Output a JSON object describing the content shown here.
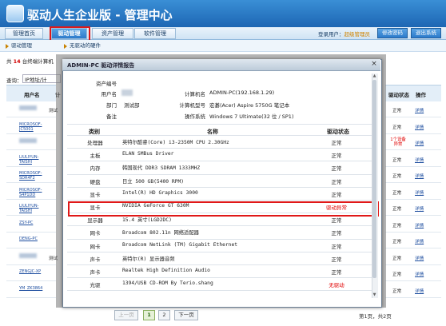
{
  "app": {
    "title": "驱动人生企业版 - 管理中心"
  },
  "nav": {
    "tabs": [
      "管理首页",
      "驱动管理",
      "资产管理",
      "软件管理"
    ],
    "login_label": "登录用户：",
    "login_user": "超级管理员",
    "change_password": "修改密码",
    "logout": "退出系统"
  },
  "subnav": {
    "items": [
      "驱动管理",
      "无驱动的硬件"
    ]
  },
  "background": {
    "count_prefix": "共",
    "count_value": "14",
    "count_suffix": "台终端计算机",
    "ip_label": "查询：",
    "ip_value": "IP地址/计",
    "col_username": "用户名",
    "col_status": "驱动状态",
    "col_action": "操作",
    "col_partial": "计",
    "rows": [
      {
        "name": "",
        "dept": "测试",
        "status": "正常",
        "action": "详情",
        "blur": true
      },
      {
        "name": "MICROSOF-JC5001",
        "dept": "",
        "status": "正常",
        "action": "详情"
      },
      {
        "name": "",
        "dept": "",
        "status": "1个设备异常",
        "action": "详情",
        "blur": true
      },
      {
        "name": "LIULIYUN-TAISHI",
        "dept": "",
        "status": "正常",
        "action": "详情"
      },
      {
        "name": "MICROSOF-SDR4F2",
        "dept": "",
        "status": "正常",
        "action": "详情"
      },
      {
        "name": "MICROSOF-S4P1DD",
        "dept": "",
        "status": "正常",
        "action": "详情"
      },
      {
        "name": "LIULIYUN-TAISHI",
        "dept": "",
        "status": "正常",
        "action": "详情"
      },
      {
        "name": "ZSY-PC",
        "dept": "",
        "status": "正常",
        "action": "详情"
      },
      {
        "name": "DENG-PC",
        "dept": "",
        "status": "正常",
        "action": "详情"
      },
      {
        "name": "",
        "dept": "测试",
        "status": "正常",
        "action": "详情",
        "blur": true
      },
      {
        "name": "ZENGJC-XP",
        "dept": "",
        "status": "正常",
        "action": "详情"
      },
      {
        "name": "YM_ZK3864",
        "dept": "",
        "status": "正常",
        "action": "详情"
      }
    ]
  },
  "dialog": {
    "title": "ADMIN-PC 驱动详情报告",
    "close": "×",
    "info": {
      "asset_label": "资产编号",
      "user_label": "用户名",
      "dept_label": "部门",
      "dept_value": "测试部",
      "note_label": "备注",
      "pc_name_label": "计算机名",
      "pc_name_value": "ADMIN-PC(192.168.1.29)",
      "pc_model_label": "计算机型号",
      "pc_model_value": "宏碁(Acer) Aspire 5750G 笔记本",
      "os_label": "操作系统",
      "os_value": "Windows 7 Ultimate(32 位 / SP1)"
    },
    "table": {
      "headers": [
        "类别",
        "名称",
        "驱动状态"
      ],
      "rows": [
        {
          "category": "处理器",
          "name": "英特尔酷睿(Core) i3-2350M CPU 2.30GHz",
          "status": "正常",
          "warn": false
        },
        {
          "category": "主板",
          "name": "ELAN SMBus Driver",
          "status": "正常",
          "warn": false
        },
        {
          "category": "内存",
          "name": "韩国现代 DDR3 SDRAM 1333MHZ",
          "status": "正常",
          "warn": false
        },
        {
          "category": "硬盘",
          "name": "日立 500 GB(5400 RPM)",
          "status": "正常",
          "warn": false
        },
        {
          "category": "显卡",
          "name": "Intel(R) HD Graphics 3000",
          "status": "正常",
          "warn": false
        },
        {
          "category": "显卡",
          "name": "NVIDIA GeForce GT 630M",
          "status": "驱动异常",
          "warn": true
        },
        {
          "category": "显示器",
          "name": "15.4 英寸(LGD2DC)",
          "status": "正常",
          "warn": false
        },
        {
          "category": "网卡",
          "name": "Broadcom 802.11n 网络适配器",
          "status": "正常",
          "warn": false
        },
        {
          "category": "网卡",
          "name": "Broadcom NetLink (TM) Gigabit Ethernet",
          "status": "正常",
          "warn": false
        },
        {
          "category": "声卡",
          "name": "英特尔(R) 显示器音频",
          "status": "正常",
          "warn": false
        },
        {
          "category": "声卡",
          "name": "Realtek High Definition Audio",
          "status": "正常",
          "warn": false
        },
        {
          "category": "光驱",
          "name": "1394/USB CD-ROM By Terio.shang",
          "status": "无驱动",
          "warn": true
        }
      ]
    }
  },
  "pager": {
    "prev": "上一页",
    "pages": [
      "1",
      "2"
    ],
    "next": "下一页",
    "info": "第1页，共2页"
  }
}
